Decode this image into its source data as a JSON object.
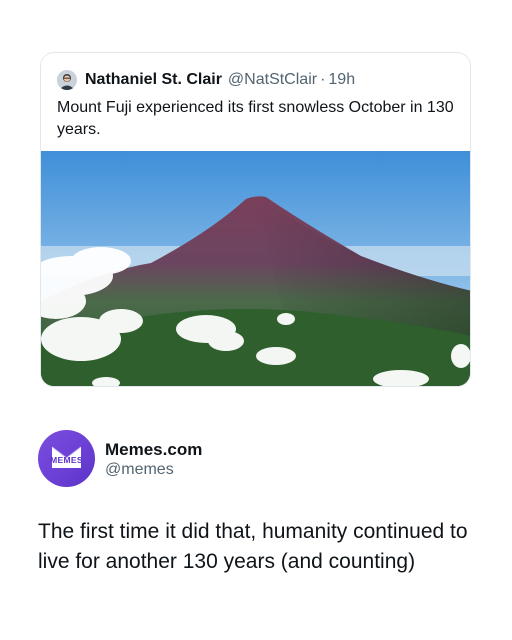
{
  "tweet": {
    "author_name": "Nathaniel St. Clair",
    "author_handle": "@NatStClair",
    "separator": "·",
    "time": "19h",
    "text": "Mount Fuji experienced its first snowless October in 130 years.",
    "avatar_icon": "person-avatar",
    "image_subject": "mountain-photo"
  },
  "post": {
    "account_name": "Memes.com",
    "account_handle": "@memes",
    "avatar_logo_text": "MEMES",
    "caption": "The first time it did that, humanity continued to live for another 130 years (and counting)"
  },
  "colors": {
    "brand_purple": "#6a3fd4",
    "handle_gray": "#536471",
    "text_dark": "#0f1419"
  }
}
